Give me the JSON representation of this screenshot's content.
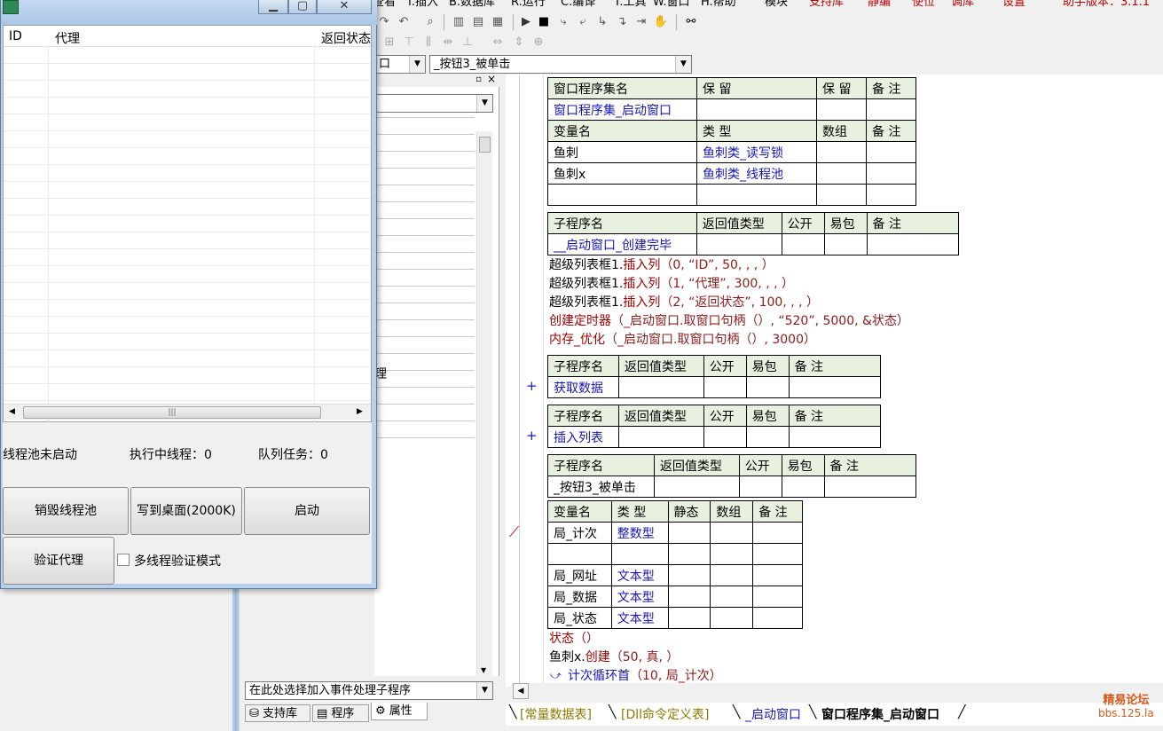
{
  "ide": {
    "menu": [
      "查看",
      "I.插入",
      "B.数据库",
      "R.运行",
      "C.编译",
      "T.工具",
      "W.窗口",
      "H.帮助",
      "模块",
      "支持库",
      "静编",
      "使位",
      "调库",
      "设置",
      "助手版本：3.1.1"
    ],
    "combo_event": "_按钮3_被单击",
    "combo_object": "口",
    "middle_panel_partial_text": "理",
    "bottom_left_combo": "在此处选择加入事件处理子程序",
    "bottom_left_tabs": [
      "支持库",
      "程序",
      "属性"
    ],
    "bottom_tabs": [
      "[常量数据表]",
      "[Dll命令定义表]",
      "_启动窗口",
      "窗口程序集_启动窗口"
    ],
    "watermark_line1": "精易论坛",
    "watermark_line2": "bbs.125.la"
  },
  "code": {
    "assembly_table": {
      "header": [
        "窗口程序集名",
        "保 留",
        "保 留",
        "备 注"
      ],
      "row": [
        "窗口程序集_启动窗口",
        "",
        "",
        ""
      ],
      "var_header": [
        "变量名",
        "类 型",
        "数组",
        "备 注"
      ],
      "vars": [
        [
          "鱼刺",
          "鱼刺类_读写锁",
          "",
          ""
        ],
        [
          "鱼刺x",
          "鱼刺类_线程池",
          "",
          ""
        ],
        [
          "",
          "",
          "",
          ""
        ]
      ]
    },
    "sub1": {
      "header": [
        "子程序名",
        "返回值类型",
        "公开",
        "易包",
        "备 注"
      ],
      "row": [
        "__启动窗口_创建完毕",
        "",
        "",
        "",
        ""
      ]
    },
    "lines1": [
      {
        "a": "超级列表框1.",
        "b": "插入列",
        "c": "（0, “ID”, 50, , , ）"
      },
      {
        "a": "超级列表框1.",
        "b": "插入列",
        "c": "（1, “代理”, 300, , , ）"
      },
      {
        "a": "超级列表框1.",
        "b": "插入列",
        "c": "（2, “返回状态”, 100, , , ）"
      },
      {
        "a": "",
        "b": "创建定时器",
        "c": "（_启动窗口.取窗口句柄（）, “520”, 5000, &状态）"
      },
      {
        "a": "",
        "b": "内存_优化",
        "c": "（_启动窗口.取窗口句柄（）, 3000）"
      }
    ],
    "sub2": {
      "header": [
        "子程序名",
        "返回值类型",
        "公开",
        "易包",
        "备 注"
      ],
      "row": [
        "获取数据",
        "",
        "",
        "",
        ""
      ]
    },
    "sub3": {
      "header": [
        "子程序名",
        "返回值类型",
        "公开",
        "易包",
        "备 注"
      ],
      "row": [
        "插入列表",
        "",
        "",
        "",
        ""
      ]
    },
    "sub4": {
      "header": [
        "子程序名",
        "返回值类型",
        "公开",
        "易包",
        "备 注"
      ],
      "row": [
        "_按钮3_被单击",
        "",
        "",
        "",
        ""
      ]
    },
    "locals": {
      "header": [
        "变量名",
        "类 型",
        "静态",
        "数组",
        "备 注"
      ],
      "rows": [
        [
          "局_计次",
          "整数型",
          "",
          "",
          ""
        ],
        [
          "",
          "",
          "",
          "",
          ""
        ],
        [
          "局_网址",
          "文本型",
          "",
          "",
          ""
        ],
        [
          "局_数据",
          "文本型",
          "",
          "",
          ""
        ],
        [
          "局_状态",
          "文本型",
          "",
          "",
          ""
        ]
      ]
    },
    "lines2": [
      {
        "a": "",
        "b": "状态",
        "c": "（）"
      },
      {
        "a": "鱼刺x.",
        "b": "创建",
        "c": "（50, 真, ）"
      },
      {
        "a": "",
        "b": "计次循环首",
        "c": "（10, 局_计次）"
      }
    ],
    "plus": "+"
  },
  "window": {
    "list_headers": [
      "ID",
      "代理",
      "返回状态"
    ],
    "status_pool": "线程池未启动",
    "status_running": "执行中线程：0",
    "status_queue": "队列任务：0",
    "buttons": {
      "destroy": "销毁线程池",
      "write": "写到桌面(2000K)",
      "start": "启动",
      "verify": "验证代理"
    },
    "checkbox_label": "多线程验证模式",
    "checkbox_checked": false
  }
}
